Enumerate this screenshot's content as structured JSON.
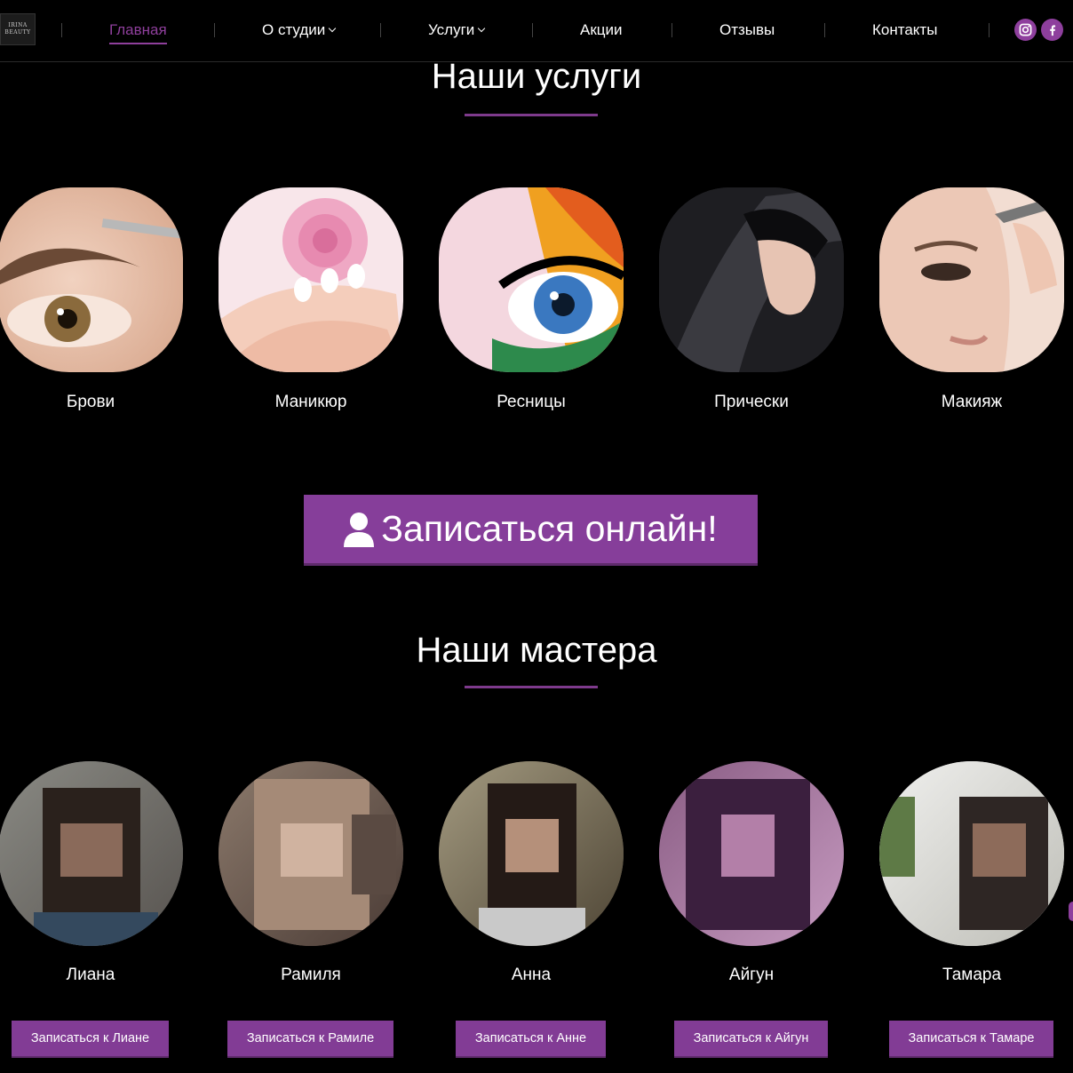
{
  "logo": {
    "line1": "IRINA",
    "line2": "BEAUTY"
  },
  "nav": {
    "items": [
      {
        "label": "Главная",
        "active": true,
        "dropdown": false
      },
      {
        "label": "О студии",
        "active": false,
        "dropdown": true
      },
      {
        "label": "Услуги",
        "active": false,
        "dropdown": true
      },
      {
        "label": "Акции",
        "active": false,
        "dropdown": false
      },
      {
        "label": "Отзывы",
        "active": false,
        "dropdown": false
      },
      {
        "label": "Контакты",
        "active": false,
        "dropdown": false
      }
    ],
    "social": [
      {
        "icon": "instagram-icon"
      },
      {
        "icon": "facebook-icon"
      }
    ]
  },
  "services": {
    "title": "Наши услуги",
    "items": [
      {
        "label": "Брови"
      },
      {
        "label": "Маникюр"
      },
      {
        "label": "Ресницы"
      },
      {
        "label": "Прически"
      },
      {
        "label": "Макияж"
      }
    ]
  },
  "cta": {
    "label": "Записаться онлайн!",
    "icon": "user-icon"
  },
  "masters": {
    "title": "Наши мастера",
    "items": [
      {
        "name": "Лиана",
        "button": "Записаться к Лиане"
      },
      {
        "name": "Рамиля",
        "button": "Записаться к Рамиле"
      },
      {
        "name": "Анна",
        "button": "Записаться к Анне"
      },
      {
        "name": "Айгун",
        "button": "Записаться к Айгун"
      },
      {
        "name": "Тамара",
        "button": "Записаться к Тамаре"
      }
    ]
  },
  "colors": {
    "accent": "#863e9a",
    "background": "#000000",
    "text": "#ffffff"
  }
}
